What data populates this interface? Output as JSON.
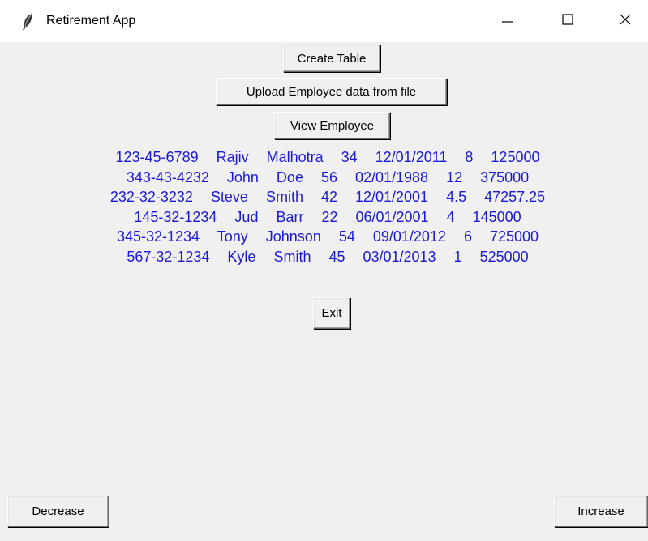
{
  "window": {
    "title": "Retirement App",
    "icon": "feather-icon",
    "controls": [
      "minimize-icon",
      "maximize-icon",
      "close-icon"
    ]
  },
  "buttons": {
    "create_table": "Create Table",
    "upload_employee": "Upload Employee data from file",
    "view_employee": "View Employee",
    "exit": "Exit",
    "decrease": "Decrease",
    "increase": "Increase"
  },
  "employees": [
    "123-45-6789  Rajiv  Malhotra  34  12/01/2011  8  125000",
    "343-43-4232  John  Doe  56  02/01/1988  12  375000",
    "232-32-3232  Steve  Smith  42  12/01/2001  4.5  47257.25",
    "145-32-1234  Jud  Barr  22  06/01/2001  4  145000",
    "345-32-1234  Tony  Johnson  54  09/01/2012  6  725000",
    "567-32-1234  Kyle  Smith  45  03/01/2013  1  525000"
  ],
  "colors": {
    "window_bg": "#f0f0f0",
    "titlebar_bg": "#ffffff",
    "employee_text": "#1a1adb"
  }
}
